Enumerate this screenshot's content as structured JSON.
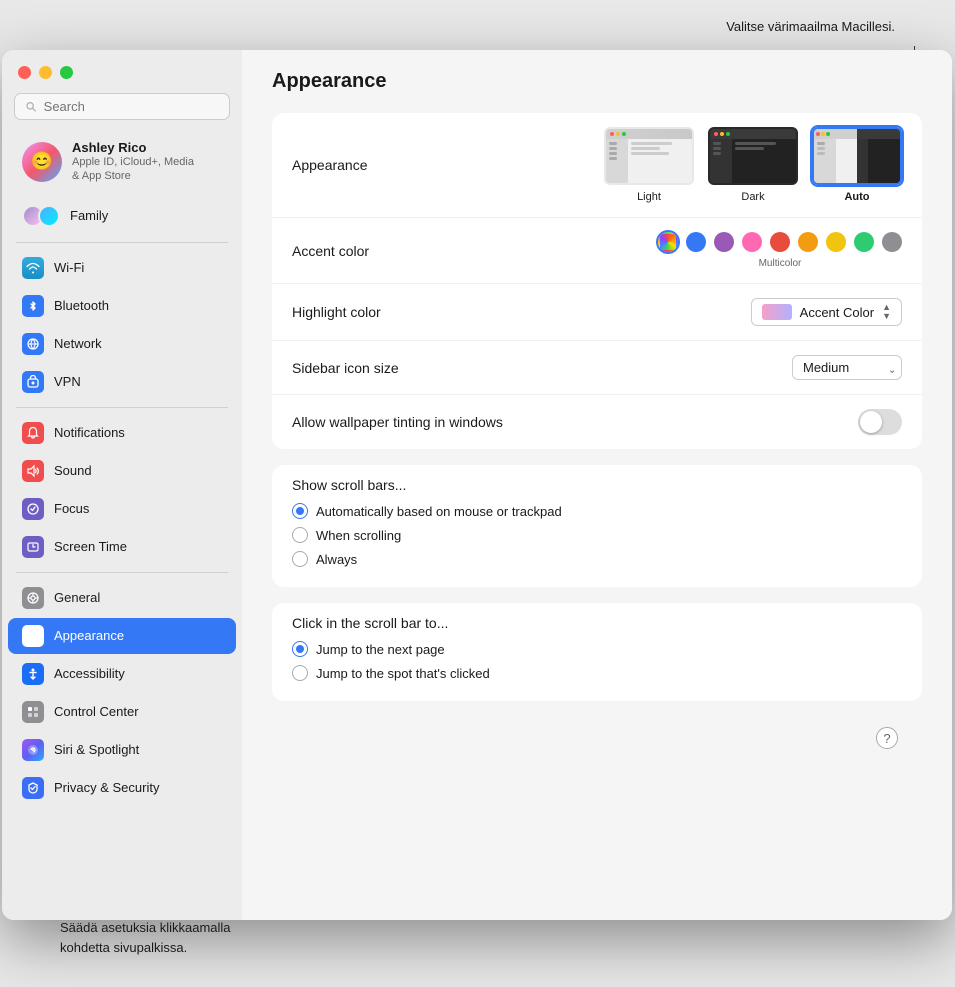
{
  "annotation_top": "Valitse värimaailma Macillesi.",
  "annotation_bottom": "Säädä asetuksia klikkaamalla\nkohdetta sivupalkissa.",
  "window_title": "Appearance",
  "sidebar": {
    "search_placeholder": "Search",
    "profile": {
      "name": "Ashley Rico",
      "subtitle": "Apple ID, iCloud+, Media\n& App Store"
    },
    "family_label": "Family",
    "items": [
      {
        "id": "wifi",
        "label": "Wi-Fi",
        "icon": "wifi"
      },
      {
        "id": "bluetooth",
        "label": "Bluetooth",
        "icon": "bluetooth"
      },
      {
        "id": "network",
        "label": "Network",
        "icon": "network"
      },
      {
        "id": "vpn",
        "label": "VPN",
        "icon": "vpn"
      },
      {
        "id": "notifications",
        "label": "Notifications",
        "icon": "notifications"
      },
      {
        "id": "sound",
        "label": "Sound",
        "icon": "sound"
      },
      {
        "id": "focus",
        "label": "Focus",
        "icon": "focus"
      },
      {
        "id": "screentime",
        "label": "Screen Time",
        "icon": "screentime"
      },
      {
        "id": "general",
        "label": "General",
        "icon": "general"
      },
      {
        "id": "appearance",
        "label": "Appearance",
        "icon": "appearance",
        "active": true
      },
      {
        "id": "accessibility",
        "label": "Accessibility",
        "icon": "accessibility"
      },
      {
        "id": "controlcenter",
        "label": "Control Center",
        "icon": "controlcenter"
      },
      {
        "id": "siri",
        "label": "Siri & Spotlight",
        "icon": "siri"
      },
      {
        "id": "privacy",
        "label": "Privacy & Security",
        "icon": "privacy"
      }
    ]
  },
  "main": {
    "title": "Appearance",
    "appearance_label": "Appearance",
    "appearance_options": [
      {
        "id": "light",
        "label": "Light",
        "selected": false
      },
      {
        "id": "dark",
        "label": "Dark",
        "selected": false
      },
      {
        "id": "auto",
        "label": "Auto",
        "selected": true
      }
    ],
    "accent_color_label": "Accent color",
    "accent_colors": [
      {
        "id": "multicolor",
        "color": "multicolor",
        "label": "Multicolor",
        "selected": true
      },
      {
        "id": "blue",
        "color": "#3478f6"
      },
      {
        "id": "purple",
        "color": "#9b59b6"
      },
      {
        "id": "pink",
        "color": "#ff69b4"
      },
      {
        "id": "red",
        "color": "#e74c3c"
      },
      {
        "id": "orange",
        "color": "#f39c12"
      },
      {
        "id": "yellow",
        "color": "#f1c40f"
      },
      {
        "id": "green",
        "color": "#2ecc71"
      },
      {
        "id": "graphite",
        "color": "#8e8e93"
      }
    ],
    "highlight_color_label": "Highlight color",
    "highlight_color_value": "Accent Color",
    "sidebar_icon_size_label": "Sidebar icon size",
    "sidebar_icon_size_value": "Medium",
    "wallpaper_tinting_label": "Allow wallpaper tinting in windows",
    "wallpaper_tinting_on": false,
    "show_scroll_bars_label": "Show scroll bars...",
    "scroll_bar_options": [
      {
        "id": "auto",
        "label": "Automatically based on mouse or trackpad",
        "selected": true
      },
      {
        "id": "scrolling",
        "label": "When scrolling",
        "selected": false
      },
      {
        "id": "always",
        "label": "Always",
        "selected": false
      }
    ],
    "click_scroll_bar_label": "Click in the scroll bar to...",
    "click_scroll_options": [
      {
        "id": "next_page",
        "label": "Jump to the next page",
        "selected": true
      },
      {
        "id": "spot_clicked",
        "label": "Jump to the spot that's clicked",
        "selected": false
      }
    ],
    "help_button_label": "?"
  }
}
